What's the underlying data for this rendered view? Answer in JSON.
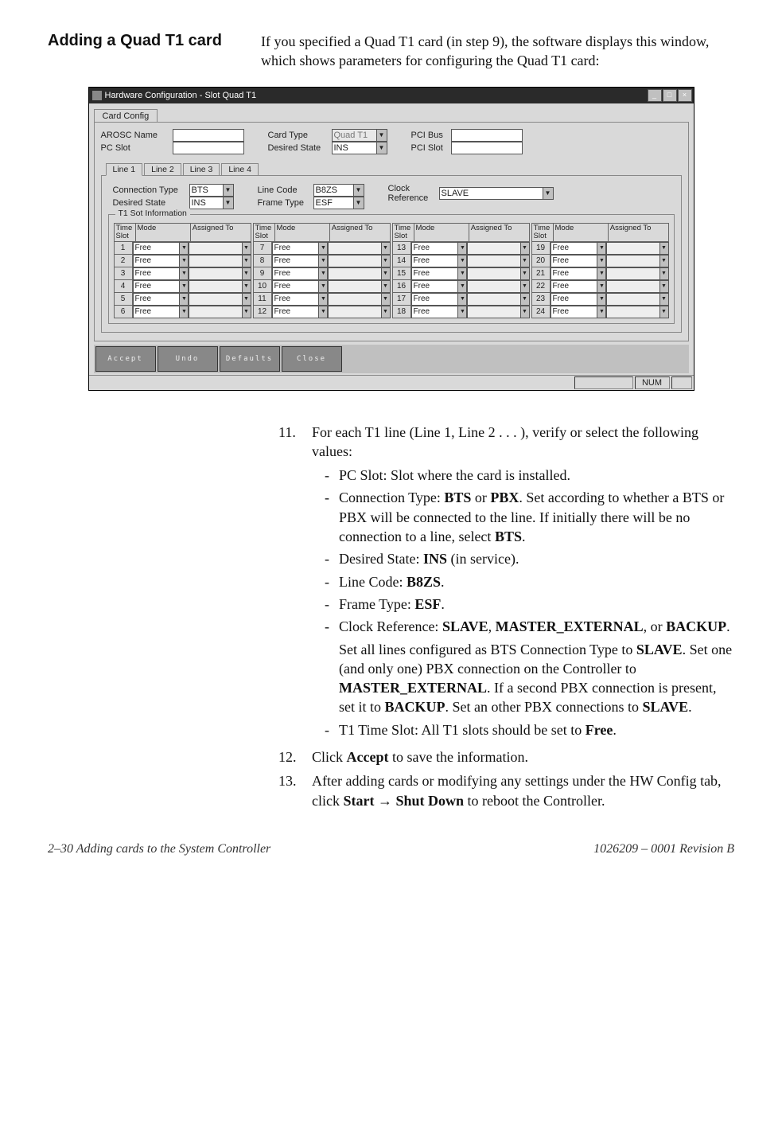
{
  "heading": "Adding a Quad T1 card",
  "intro": "If you specified a Quad T1 card (in step 9), the software displays this window, which shows parameters for configuring the Quad T1 card:",
  "dialog": {
    "title": "Hardware Configuration - Slot   Quad T1",
    "tab": "Card Config",
    "topFields": {
      "aroscName": {
        "label": "AROSC Name",
        "value": ""
      },
      "pcSlot": {
        "label": "PC Slot",
        "value": ""
      },
      "cardType": {
        "label": "Card Type",
        "value": "Quad T1"
      },
      "desiredState": {
        "label": "Desired State",
        "value": "INS"
      },
      "pciBus": {
        "label": "PCI Bus",
        "value": ""
      },
      "pciSlot": {
        "label": "PCI Slot",
        "value": ""
      }
    },
    "lineTabs": [
      "Line 1",
      "Line 2",
      "Line 3",
      "Line 4"
    ],
    "lineFields": {
      "connectionType": {
        "label": "Connection Type",
        "value": "BTS"
      },
      "desiredState": {
        "label": "Desired State",
        "value": "INS"
      },
      "lineCode": {
        "label": "Line Code",
        "value": "B8ZS"
      },
      "frameType": {
        "label": "Frame Type",
        "value": "ESF"
      },
      "clockRef": {
        "label": "Clock Reference",
        "value": "SLAVE"
      }
    },
    "slotInfoTitle": "T1 Sot Information",
    "slotHeaders": {
      "timeSlot": "Time Slot",
      "mode": "Mode",
      "assignedTo": "Assigned To"
    },
    "slotCols": [
      [
        {
          "n": "1",
          "mode": "Free"
        },
        {
          "n": "2",
          "mode": "Free"
        },
        {
          "n": "3",
          "mode": "Free"
        },
        {
          "n": "4",
          "mode": "Free"
        },
        {
          "n": "5",
          "mode": "Free"
        },
        {
          "n": "6",
          "mode": "Free"
        }
      ],
      [
        {
          "n": "7",
          "mode": "Free"
        },
        {
          "n": "8",
          "mode": "Free"
        },
        {
          "n": "9",
          "mode": "Free"
        },
        {
          "n": "10",
          "mode": "Free"
        },
        {
          "n": "11",
          "mode": "Free"
        },
        {
          "n": "12",
          "mode": "Free"
        }
      ],
      [
        {
          "n": "13",
          "mode": "Free"
        },
        {
          "n": "14",
          "mode": "Free"
        },
        {
          "n": "15",
          "mode": "Free"
        },
        {
          "n": "16",
          "mode": "Free"
        },
        {
          "n": "17",
          "mode": "Free"
        },
        {
          "n": "18",
          "mode": "Free"
        }
      ],
      [
        {
          "n": "19",
          "mode": "Free"
        },
        {
          "n": "20",
          "mode": "Free"
        },
        {
          "n": "21",
          "mode": "Free"
        },
        {
          "n": "22",
          "mode": "Free"
        },
        {
          "n": "23",
          "mode": "Free"
        },
        {
          "n": "24",
          "mode": "Free"
        }
      ]
    ],
    "toolbar": [
      "Accept",
      "Undo",
      "Defaults",
      "Close"
    ],
    "status": "NUM"
  },
  "steps": [
    {
      "num": "11.",
      "text": "For each T1 line (Line 1, Line 2 . . . ), verify or select the following values:",
      "subs": [
        {
          "text": "PC Slot: Slot where the card is installed."
        },
        {
          "html": "Connection Type: <strong>BTS</strong> or <strong>PBX</strong>. Set according to whether a BTS or PBX will be connected to the line. If initially there will be no connection to a line, select <strong>BTS</strong>."
        },
        {
          "html": "Desired State: <strong>INS</strong> (in service)."
        },
        {
          "html": "Line Code: <strong>B8ZS</strong>."
        },
        {
          "html": "Frame Type: <strong>ESF</strong>."
        },
        {
          "html": "Clock Reference: <strong>SLAVE</strong>, <strong>MASTER_EXTERNAL</strong>, or <strong>BACKUP</strong>.",
          "extraHtml": "Set all lines configured as BTS Connection Type to <strong>SLAVE</strong>. Set one (and only one) PBX connection on the Controller to <strong>MASTER_EXTERNAL</strong>. If a second PBX connection is present, set it to <strong>BACKUP</strong>. Set an other PBX connections to <strong>SLAVE</strong>."
        },
        {
          "html": "T1 Time Slot: All T1 slots should be set to <strong>Free</strong>."
        }
      ]
    },
    {
      "num": "12.",
      "html": "Click <strong>Accept</strong> to save the information."
    },
    {
      "num": "13.",
      "html": "After adding cards or modifying any settings under the HW Config tab, click <strong>Start</strong> <span class='arrow'>&rarr;</span> <strong>Shut Down</strong> to reboot the Controller."
    }
  ],
  "footer": {
    "left": "2–30  Adding cards to the System Controller",
    "right": "1026209 – 0001  Revision B"
  }
}
